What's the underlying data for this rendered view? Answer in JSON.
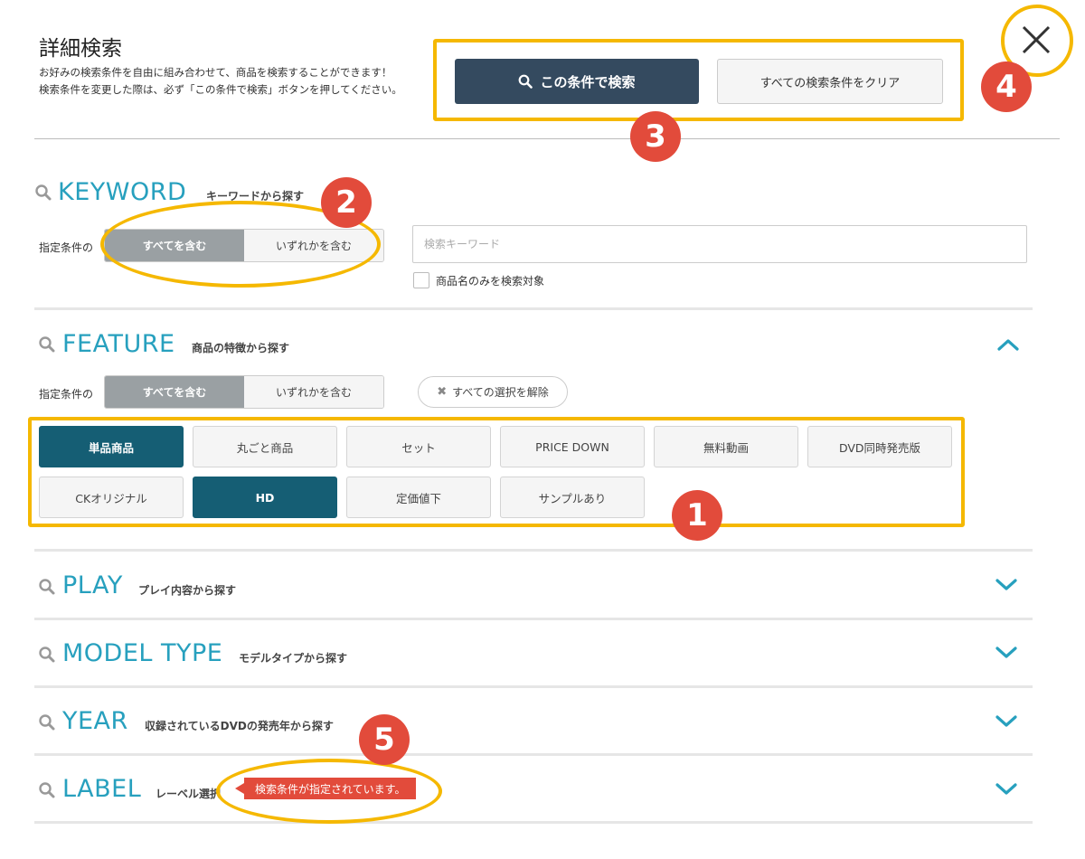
{
  "header": {
    "title": "詳細検索",
    "desc_line1": "お好みの検索条件を自由に組み合わせて、商品を検索することができます！",
    "desc_line2": "検索条件を変更した際は、必ず「この条件で検索」ボタンを押してください。",
    "search_button": "この条件で検索",
    "clear_button": "すべての検索条件をクリア"
  },
  "badges": [
    "1",
    "2",
    "3",
    "4",
    "5"
  ],
  "keyword": {
    "title": "KEYWORD",
    "subtitle": "キーワードから探す",
    "cond_label": "指定条件の",
    "toggle": [
      "すべてを含む",
      "いずれかを含む"
    ],
    "placeholder": "検索キーワード",
    "checkbox_label": "商品名のみを検索対象"
  },
  "feature": {
    "title": "FEATURE",
    "subtitle": "商品の特徴から探す",
    "cond_label": "指定条件の",
    "toggle": [
      "すべてを含む",
      "いずれかを含む"
    ],
    "deselect": "すべての選択を解除",
    "tags": [
      "単品商品",
      "丸ごと商品",
      "セット",
      "PRICE DOWN",
      "無料動画",
      "DVD同時発売版",
      "CKオリジナル",
      "HD",
      "定価値下",
      "サンプルあり"
    ]
  },
  "play": {
    "title": "PLAY",
    "subtitle": "プレイ内容から探す"
  },
  "model_type": {
    "title": "MODEL TYPE",
    "subtitle": "モデルタイプから探す"
  },
  "year": {
    "title": "YEAR",
    "subtitle": "収録されているDVDの発売年から探す"
  },
  "label": {
    "title": "LABEL",
    "subtitle": "レーベル選択",
    "tooltip": "検索条件が指定されています。"
  },
  "colors": {
    "accent": "#27a0be",
    "dark_button": "#344a5f",
    "selected_tag": "#155e74",
    "highlight": "#f5b800",
    "badge": "#e24b3b"
  }
}
